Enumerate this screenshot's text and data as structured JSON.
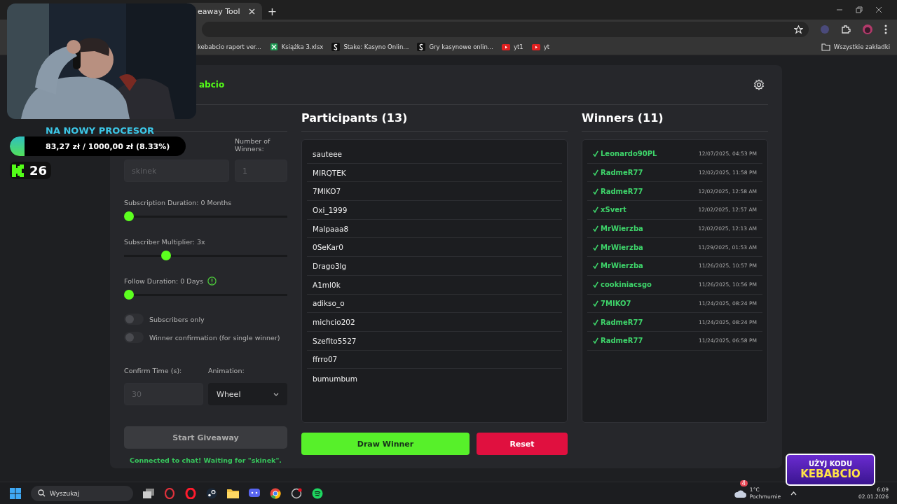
{
  "browser": {
    "tab_title": "eaway Tool",
    "new_tab": "+",
    "bookmarks": [
      {
        "label": "kebabcio raport ver...",
        "kind": "plain"
      },
      {
        "label": "Książka 3.xlsx",
        "kind": "sheet"
      },
      {
        "label": "Stake: Kasyno Onlin...",
        "kind": "letter"
      },
      {
        "label": "Gry kasynowe onlin...",
        "kind": "letter"
      },
      {
        "label": "yt1",
        "kind": "video"
      },
      {
        "label": "yt",
        "kind": "video"
      }
    ],
    "all_bookmarks": "Wszystkie zakładki"
  },
  "app": {
    "title": "abcio"
  },
  "settings": {
    "winners_label": "Number of Winners:",
    "channel_placeholder": "skinek",
    "winners_placeholder": "1",
    "sliders": [
      {
        "label": "Subscription Duration: 0 Months",
        "level": 0,
        "info": false
      },
      {
        "label": "Subscriber Multiplier: 3x",
        "level": 0.24,
        "info": false
      },
      {
        "label": "Follow Duration: 0 Days",
        "level": 0,
        "info": true
      }
    ],
    "toggles": [
      {
        "label": "Subscribers only",
        "on": false
      },
      {
        "label": "Winner confirmation (for single winner)",
        "on": false
      }
    ],
    "confirm_label": "Confirm Time (s):",
    "confirm_placeholder": "30",
    "animation_label": "Animation:",
    "animation_value": "Wheel",
    "start_button": "Start Giveaway",
    "status": "Connected to chat! Waiting for \"skinek\"."
  },
  "participants": {
    "title": "Participants (13)",
    "names": [
      "sauteee",
      "MIRQTEK",
      "7MIKO7",
      "Oxi_1999",
      "Malpaaa8",
      "0SeKar0",
      "Drago3lg",
      "A1ml0k",
      "adikso_o",
      "michcio202",
      "Szefito5527",
      "ffrro07",
      "bumumbum"
    ],
    "draw_button": "Draw Winner",
    "reset_button": "Reset"
  },
  "winners": {
    "title": "Winners (11)",
    "items": [
      {
        "name": "Leonardo90PL",
        "time": "12/07/2025, 04:53 PM"
      },
      {
        "name": "RadmeR77",
        "time": "12/02/2025, 11:58 PM"
      },
      {
        "name": "RadmeR77",
        "time": "12/02/2025, 12:58 AM"
      },
      {
        "name": "xSvert",
        "time": "12/02/2025, 12:57 AM"
      },
      {
        "name": "MrWierzba",
        "time": "12/02/2025, 12:13 AM"
      },
      {
        "name": "MrWierzba",
        "time": "11/29/2025, 01:53 AM"
      },
      {
        "name": "MrWierzba",
        "time": "11/26/2025, 10:57 PM"
      },
      {
        "name": "cookiniacsgo",
        "time": "11/26/2025, 10:56 PM"
      },
      {
        "name": "7MIKO7",
        "time": "11/24/2025, 08:24 PM"
      },
      {
        "name": "RadmeR77",
        "time": "11/24/2025, 08:24 PM"
      },
      {
        "name": "RadmeR77",
        "time": "11/24/2025, 06:58 PM"
      }
    ]
  },
  "overlay": {
    "goal_title": "NA NOWY PROCESOR",
    "goal_text": "83,27 zł / 1000,00 zł (8.33%)",
    "level": 0.0833,
    "viewer_count": "26",
    "promo_line1": "UŻYJ KODU",
    "promo_line2": "KEBABCIO"
  },
  "taskbar": {
    "search_placeholder": "Wyszukaj",
    "weather_badge": "4",
    "weather_temp": "1°C",
    "weather_text": "Pochmurnie",
    "time": "6:09",
    "date": "02.01.2026"
  }
}
